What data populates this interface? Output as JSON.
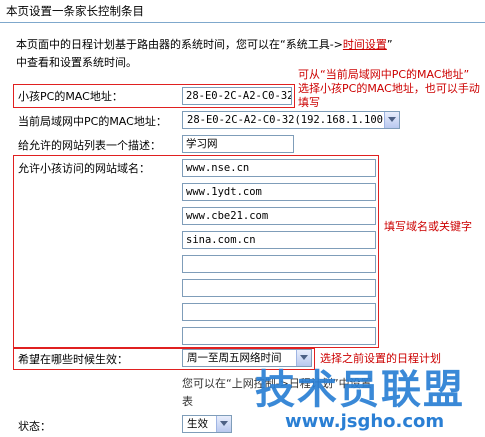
{
  "page": {
    "title": "本页设置一条家长控制条目",
    "intro_line1_prefix": "本页面中的日程计划基于路由器的系统时间，您可以在“系统工具->",
    "intro_link": "时间设置",
    "intro_line1_suffix": "”",
    "intro_line2": "中查看和设置系统时间。"
  },
  "form": {
    "child_mac_label": "小孩PC的MAC地址：",
    "child_mac_value": "28-E0-2C-A2-C0-32",
    "lan_mac_label": "当前局域网中PC的MAC地址：",
    "lan_mac_selected": "28-E0-2C-A2-C0-32(192.168.1.100)",
    "desc_label": "给允许的网站列表一个描述：",
    "desc_value": "学习网",
    "sites_label": "允许小孩访问的网站域名：",
    "sites": [
      "www.nse.cn",
      "www.1ydt.com",
      "www.cbe21.com",
      "sina.com.cn",
      "",
      "",
      "",
      ""
    ],
    "schedule_label": "希望在哪些时候生效：",
    "schedule_selected": "周一至周五网络时间",
    "schedule_hint": "您可以在“上网控制->日程计划”中设置",
    "schedule_hint2": "表",
    "status_label": "状态：",
    "status_selected": "生效"
  },
  "annotations": {
    "mac_note_line1": "可从“当前局域网中PC的MAC地址”",
    "mac_note_line2": "选择小孩PC的MAC地址，也可以手动",
    "mac_note_line3": "填写",
    "sites_note": "填写域名或关键字",
    "schedule_note": "选择之前设置的日程计划"
  },
  "watermark": {
    "text": "技术员联盟",
    "url": "www.jsgho.com"
  },
  "colors": {
    "annotation_red": "#cc0000",
    "box_red": "#e02020",
    "watermark_blue": "#2a7fd4"
  }
}
